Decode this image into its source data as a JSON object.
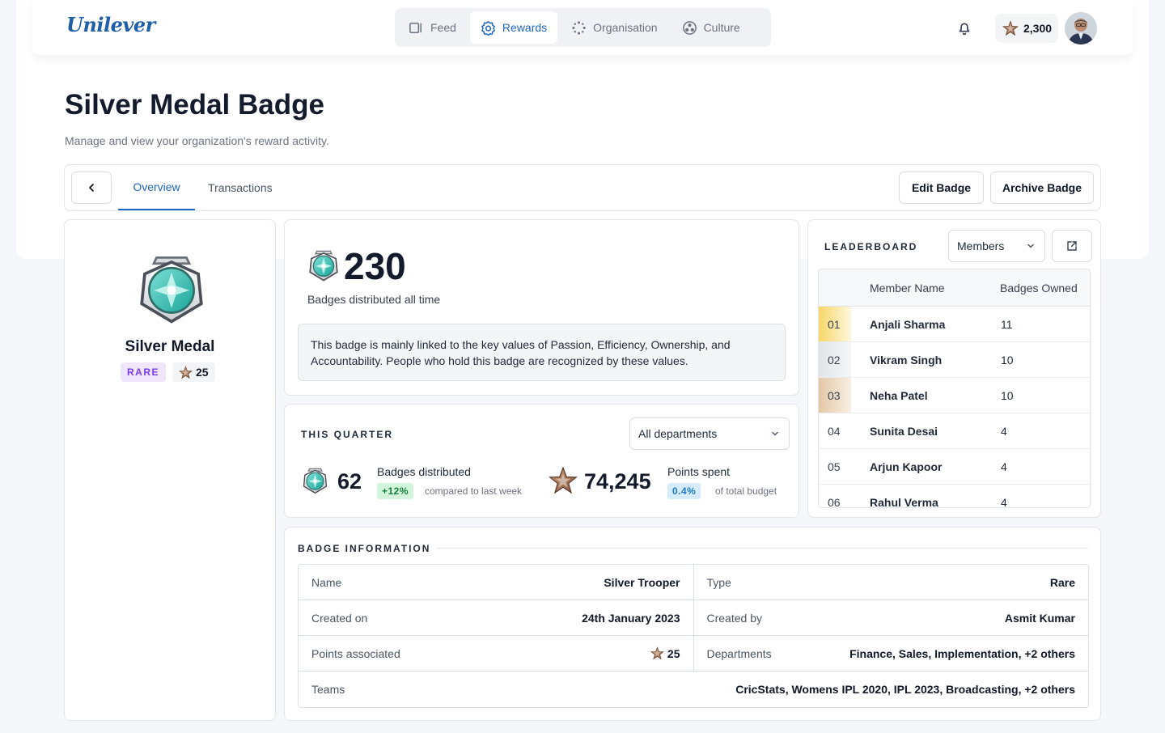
{
  "brand": {
    "logo_text": "Unilever",
    "accent": "#1e66c4"
  },
  "nav": {
    "items": [
      {
        "label": "Feed",
        "icon": "feed-icon"
      },
      {
        "label": "Rewards",
        "icon": "rewards-icon",
        "active": true
      },
      {
        "label": "Organisation",
        "icon": "organisation-icon"
      },
      {
        "label": "Culture",
        "icon": "culture-icon"
      }
    ]
  },
  "header": {
    "points": "2,300"
  },
  "page": {
    "title": "Silver Medal Badge",
    "subtitle": "Manage and view your organization's reward activity."
  },
  "tabs": {
    "overview": "Overview",
    "transactions": "Transactions"
  },
  "actions": {
    "edit": "Edit Badge",
    "archive": "Archive Badge"
  },
  "badge": {
    "name": "Silver Medal",
    "rarity": "RARE",
    "points": "25"
  },
  "all_time": {
    "count": "230",
    "label": "Badges distributed all time",
    "description": "This badge is mainly linked to the key values of Passion, Efficiency, Ownership, and Accountability. People who hold this badge are recognized by these values."
  },
  "quarter": {
    "title": "THIS QUARTER",
    "filter_value": "All departments",
    "distributed_count": "62",
    "distributed_label": "Badges distributed",
    "distributed_delta": "+12%",
    "distributed_note": "compared to last week",
    "points_count": "74,245",
    "points_label": "Points spent",
    "points_delta": "0.4%",
    "points_note": "of total budget"
  },
  "leaderboard": {
    "title": "LEADERBOARD",
    "filter_value": "Members",
    "columns": [
      "Member Name",
      "Badges Owned"
    ],
    "rows": [
      {
        "rank": "01",
        "name": "Anjali Sharma",
        "count": "11"
      },
      {
        "rank": "02",
        "name": "Vikram Singh",
        "count": "10"
      },
      {
        "rank": "03",
        "name": "Neha Patel",
        "count": "10"
      },
      {
        "rank": "04",
        "name": "Sunita Desai",
        "count": "4"
      },
      {
        "rank": "05",
        "name": "Arjun Kapoor",
        "count": "4"
      },
      {
        "rank": "06",
        "name": "Rahul Verma",
        "count": "4"
      }
    ]
  },
  "info": {
    "title": "BADGE INFORMATION",
    "name_label": "Name",
    "name_value": "Silver Trooper",
    "type_label": "Type",
    "type_value": "Rare",
    "created_on_label": "Created on",
    "created_on_value": "24th January 2023",
    "created_by_label": "Created by",
    "created_by_value": "Asmit Kumar",
    "points_label": "Points associated",
    "points_value": "25",
    "departments_label": "Departments",
    "departments_value": "Finance, Sales, Implementation, +2 others",
    "teams_label": "Teams",
    "teams_value": "CricStats, Womens IPL 2020, IPL 2023, Broadcasting, +2 others"
  }
}
